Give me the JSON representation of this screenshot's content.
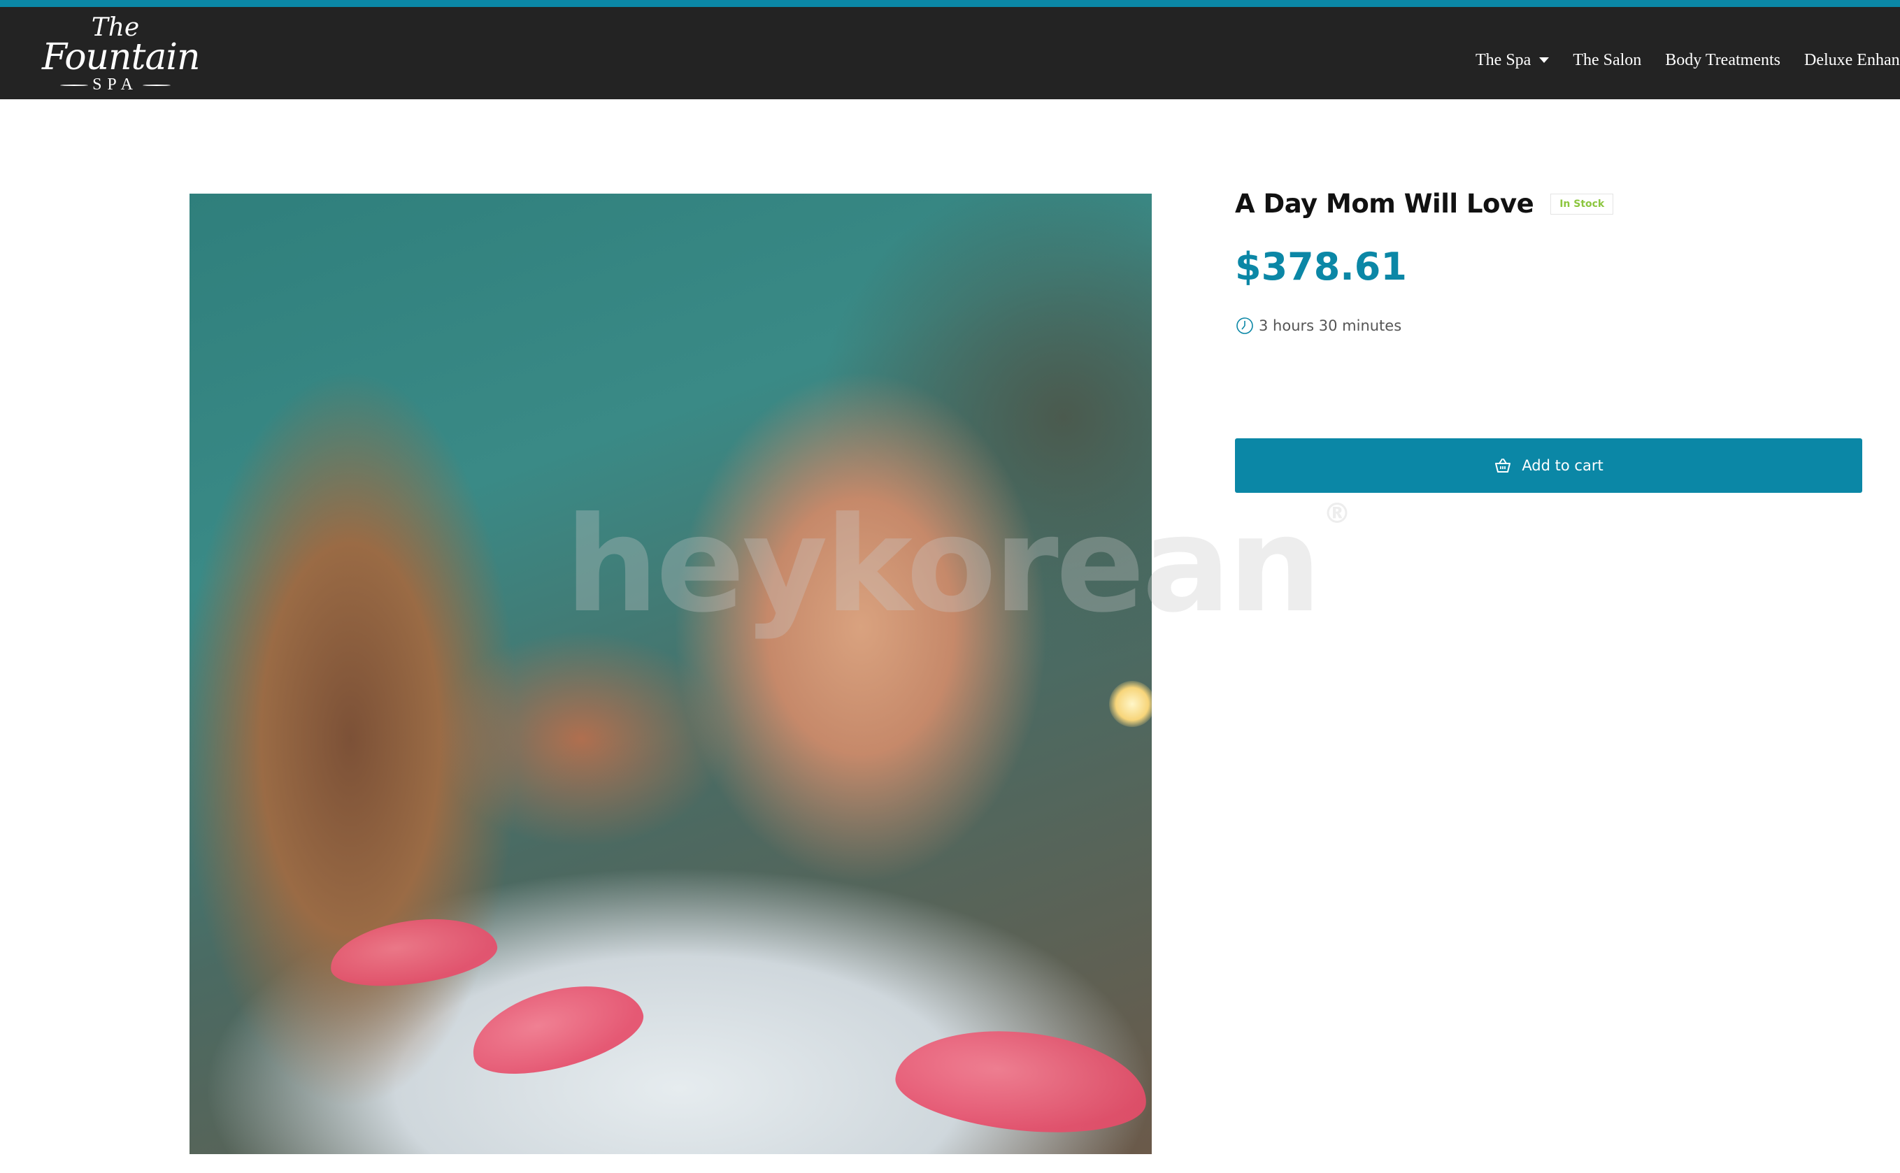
{
  "brand": {
    "logo_line1": "The",
    "logo_line2": "Fountain",
    "logo_line3": "SPA"
  },
  "nav": {
    "items": [
      {
        "label": "The Spa",
        "has_dropdown": true
      },
      {
        "label": "The Salon",
        "has_dropdown": false
      },
      {
        "label": "Body Treatments",
        "has_dropdown": false
      },
      {
        "label": "Deluxe Enhanc",
        "has_dropdown": false
      }
    ]
  },
  "product": {
    "title": "A Day Mom Will Love",
    "stock_label": "In Stock",
    "price": "$378.61",
    "duration": "3 hours 30 minutes",
    "add_to_cart_label": "Add to cart",
    "image_watermark": "heykorean",
    "image_watermark_mark": "®"
  },
  "icons": {
    "zoom": "magnifier-icon",
    "clock": "clock-icon",
    "cart": "basket-icon",
    "dropdown": "caret-down-icon"
  },
  "colors": {
    "accent": "#0b87a6",
    "header_bg": "#232323",
    "stock_green": "#8cc63f"
  }
}
